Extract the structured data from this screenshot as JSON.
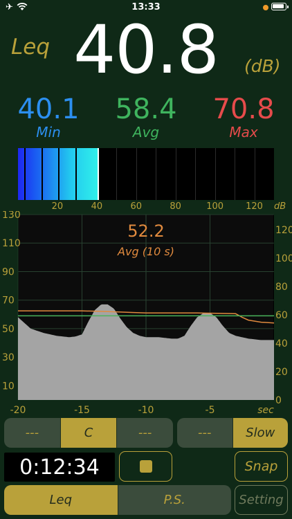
{
  "status_bar": {
    "time": "13:33",
    "airplane_glyph": "✈"
  },
  "main": {
    "mode_label": "Leq",
    "value": "40.8",
    "unit": "(dB)"
  },
  "stats": {
    "min": {
      "value": "40.1",
      "label": "Min",
      "color": "#2c8ff0"
    },
    "avg": {
      "value": "58.4",
      "label": "Avg",
      "color": "#3fb45e"
    },
    "max": {
      "value": "70.8",
      "label": "Max",
      "color": "#e64b4b"
    }
  },
  "meter": {
    "level_db": 40.8,
    "range": [
      0,
      130
    ],
    "ticks": [
      "20",
      "40",
      "60",
      "80",
      "100",
      "120"
    ],
    "unit": "dB"
  },
  "chart": {
    "readout_value": "52.2",
    "readout_label": "Avg (10 s)",
    "left_ticks": [
      "130",
      "110",
      "90",
      "70",
      "50",
      "30",
      "10"
    ],
    "right_ticks": [
      "120",
      "100",
      "80",
      "60",
      "40",
      "20",
      "0"
    ],
    "x_ticks": [
      "-20",
      "-15",
      "-10",
      "-5"
    ],
    "x_unit": "sec",
    "colors": {
      "fill": "#a7a7a7",
      "orange": "#e08a3e",
      "green": "#49b35a"
    }
  },
  "chart_data": {
    "type": "area",
    "xlim": [
      -20,
      0
    ],
    "ylim": [
      0,
      130
    ],
    "series": [
      {
        "x": [
          -20,
          -19,
          -18,
          -17,
          -16,
          -15.5,
          -15,
          -14.5,
          -14,
          -13.5,
          -13,
          -12.5,
          -12,
          -11.5,
          -11,
          -10.5,
          -10,
          -9,
          -8,
          -7.5,
          -7,
          -6.5,
          -6,
          -5.5,
          -5,
          -4.5,
          -4,
          -3.5,
          -3,
          -2,
          -1,
          0
        ],
        "values": [
          58,
          50,
          47,
          45,
          44,
          44.5,
          46,
          55,
          63,
          67,
          67,
          64,
          57,
          51,
          47,
          45,
          44,
          44,
          43,
          43,
          45,
          52,
          58,
          61,
          61,
          58,
          52,
          47,
          45,
          43,
          42,
          42
        ]
      },
      {
        "x": [
          -20,
          -15,
          -13,
          -10,
          -6,
          -3,
          -2.5,
          -2,
          -1,
          0
        ],
        "values": [
          62.5,
          62.5,
          62,
          61,
          61,
          60.5,
          58,
          56,
          54.5,
          54
        ]
      },
      {
        "x": [
          -20,
          -15,
          -10,
          -5,
          0
        ],
        "values": [
          59,
          59,
          59,
          59,
          59
        ]
      }
    ]
  },
  "controls": {
    "weighting": {
      "items": [
        "---",
        "C",
        "---"
      ],
      "selected": 1
    },
    "speed": {
      "items": [
        "---",
        "Slow"
      ],
      "selected": 1
    },
    "timer": "0:12:34",
    "snap_label": "Snap",
    "mode": {
      "items": [
        "Leq",
        "P.S."
      ],
      "selected": 0
    },
    "setting_label": "Setting"
  }
}
